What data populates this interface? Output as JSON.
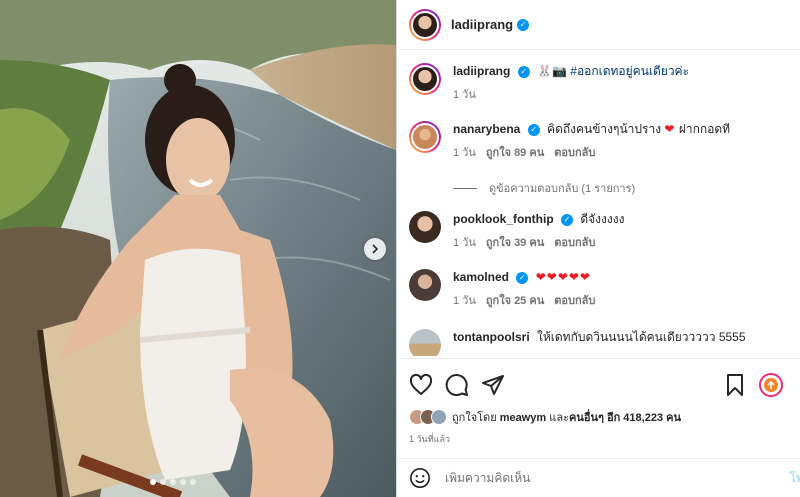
{
  "post": {
    "author": "ladiiprang",
    "verified": true,
    "carousel": {
      "slides": 5,
      "active": 0
    }
  },
  "comments": [
    {
      "user": "ladiiprang",
      "verified": true,
      "text_emoji": "🐰📷",
      "text": "#ออกเดทอยู่คนเดียวค่ะ",
      "time": "1 วัน",
      "likes": "",
      "reply": ""
    },
    {
      "user": "nanarybena",
      "verified": true,
      "text": "คิดถึงคนข้างๆน้าปราง",
      "heart": "❤",
      "text2": "ฝากกอดที",
      "time": "1 วัน",
      "likes": "ถูกใจ 89 คน",
      "reply": "ตอบกลับ"
    },
    {
      "user": "pooklook_fonthip",
      "verified": true,
      "text": "ดีจังงงงง",
      "time": "1 วัน",
      "likes": "ถูกใจ 39 คน",
      "reply": "ตอบกลับ"
    },
    {
      "user": "kamolned",
      "verified": true,
      "text": "❤❤❤❤❤",
      "time": "1 วัน",
      "likes": "ถูกใจ 25 คน",
      "reply": "ตอบกลับ"
    },
    {
      "user": "tontanpoolsri",
      "verified": false,
      "text": "ให้เดทกับดวินนนนได้คนเดียววววว 5555",
      "time": "",
      "likes": "",
      "reply": ""
    }
  ],
  "view_replies": "ดูข้อความตอบกลับ (1 รายการ)",
  "icons": [
    "heart-icon",
    "comment-icon",
    "share-icon",
    "bookmark-icon",
    "story-icon",
    "chevron-right-icon",
    "emoji-icon"
  ],
  "likes": {
    "prefix": "ถูกใจโดย",
    "user": "meawym",
    "and": "และ",
    "others": "คนอื่นๆ อีก 418,223 คน"
  },
  "post_time": "1 วันที่แล้ว",
  "add_comment": {
    "placeholder": "เพิ่มความคิดเห็น",
    "post_label": "โพ"
  },
  "colors": {
    "accent": "#0095f6",
    "heart": "#ed1c24",
    "text": "#262626",
    "muted": "#737373"
  }
}
